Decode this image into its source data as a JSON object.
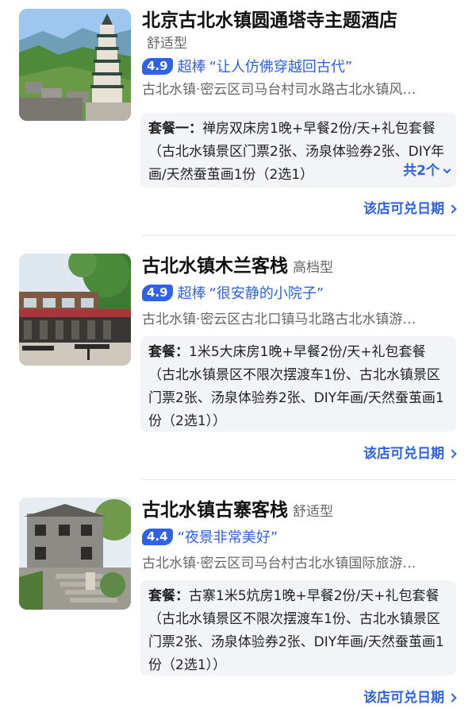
{
  "hotels": [
    {
      "name": "北京古北水镇圆通塔寺主题酒店",
      "type": "舒适型",
      "score": "4.9",
      "level": "超棒",
      "quote": "“让人仿佛穿越回古代”",
      "address": "古北水镇·密云区司马台村司水路古北水镇风…",
      "package_label": "套餐一：",
      "package_text": "禅房双床房1晚+早餐2份/天+礼包套餐（古北水镇景区门票2张、汤泉体验券2张、DIY年画/天然蚕茧画1份（2选1）",
      "package_more": "共2个",
      "link": "该店可兑日期",
      "image": "pagoda-photo"
    },
    {
      "name": "古北水镇木兰客栈",
      "type": "高档型",
      "score": "4.9",
      "level": "超棒",
      "quote": "“很安静的小院子”",
      "address": "古北水镇·密云区古北口镇马北路古北水镇游…",
      "package_label": "套餐：",
      "package_text": "1米5大床房1晚+早餐2份/天+礼包套餐（古北水镇景区不限次摆渡车1份、古北水镇景区门票2张、汤泉体验券2张、DIY年画/天然蚕茧画1份（2选1））",
      "package_more": "",
      "link": "该店可兑日期",
      "image": "courtyard-photo"
    },
    {
      "name": "古北水镇古寨客栈",
      "type": "舒适型",
      "score": "4.4",
      "level": "",
      "quote": "“夜景非常美好”",
      "address": "古北水镇·密云区司马台村古北水镇国际旅游…",
      "package_label": "套餐：",
      "package_text": "古寨1米5炕房1晚+早餐2份/天+礼包套餐（古北水镇景区不限次摆渡车1份、古北水镇景区门票2张、汤泉体验券2张、DIY年画/天然蚕茧画1份（2选1））",
      "package_more": "",
      "link": "该店可兑日期",
      "image": "stone-house-photo"
    }
  ],
  "colors": {
    "accent": "#2f62e8",
    "package_bg": "#f2f4f8",
    "secondary_text": "#666666"
  }
}
